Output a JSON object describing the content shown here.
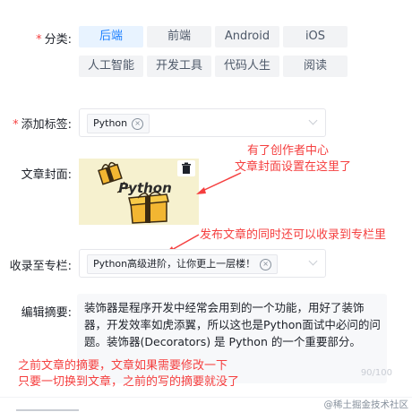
{
  "category": {
    "label": "分类:",
    "items": [
      {
        "label": "后端",
        "active": true
      },
      {
        "label": "前端",
        "active": false
      },
      {
        "label": "Android",
        "active": false
      },
      {
        "label": "iOS",
        "active": false
      },
      {
        "label": "人工智能",
        "active": false
      },
      {
        "label": "开发工具",
        "active": false
      },
      {
        "label": "代码人生",
        "active": false
      },
      {
        "label": "阅读",
        "active": false
      }
    ]
  },
  "tags": {
    "label": "添加标签:",
    "items": [
      {
        "label": "Python"
      }
    ]
  },
  "cover": {
    "label": "文章封面:",
    "image_text": "Python",
    "delete_icon": "trash-icon"
  },
  "column": {
    "label": "收录至专栏:",
    "items": [
      {
        "label": "Python高级进阶，让你更上一层楼！"
      }
    ]
  },
  "summary": {
    "label": "编辑摘要:",
    "text": "装饰器是程序开发中经常会用到的一个功能，用好了装饰器，开发效率如虎添翼，所以这也是Python面试中必问的问题。装饰器(Decorators) 是 Python 的一个重要部分。",
    "counter": "90/100"
  },
  "annotations": {
    "cover_note": [
      "有了创作者中心",
      "文章封面设置在这里了"
    ],
    "column_note": "发布文章的同时还可以收录到专栏里",
    "summary_note": [
      "之前文章的摘要，文章如果需要修改一下",
      "只要一切换到文章，之前的写的摘要就没了"
    ]
  },
  "watermark": "@稀土掘金技术社区",
  "colors": {
    "accent": "#1e80ff",
    "annotation": "#f53f3f",
    "required": "#f53f3f"
  }
}
